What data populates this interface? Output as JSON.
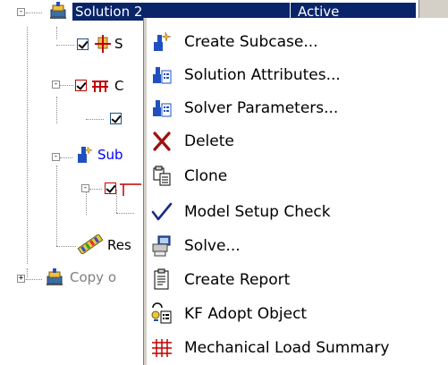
{
  "tree": {
    "rows": [
      {
        "label": "Solution 2",
        "status": "Active"
      },
      {
        "label": "S"
      },
      {
        "label": "C"
      },
      {
        "label": ""
      },
      {
        "label": "Sub"
      },
      {
        "label": ""
      },
      {
        "label": ""
      },
      {
        "label": "Res"
      },
      {
        "label": "Copy o"
      }
    ]
  },
  "context_menu": {
    "items": [
      {
        "label": "Create Subcase...",
        "icon": "create-subcase-icon"
      },
      {
        "label": "Solution Attributes...",
        "icon": "solution-attributes-icon"
      },
      {
        "label": "Solver Parameters...",
        "icon": "solver-parameters-icon"
      },
      {
        "label": "Delete",
        "icon": "delete-icon"
      },
      {
        "label": "Clone",
        "icon": "clone-icon"
      },
      {
        "label": "Model Setup Check",
        "icon": "checkmark-icon"
      },
      {
        "label": "Solve...",
        "icon": "solve-icon"
      },
      {
        "label": "Create Report",
        "icon": "report-icon"
      },
      {
        "label": "KF Adopt Object",
        "icon": "kf-adopt-icon"
      },
      {
        "label": "Mechanical Load Summary",
        "icon": "load-summary-icon"
      }
    ]
  },
  "colors": {
    "selection": "#0a246a",
    "link_blue": "#0000ff",
    "gray_text": "#808080"
  }
}
